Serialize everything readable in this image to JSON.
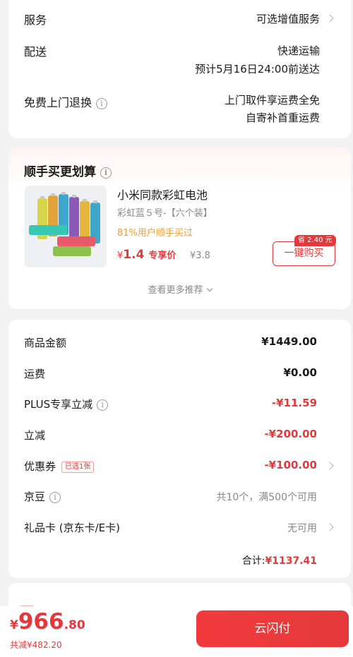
{
  "service": {
    "rows": [
      {
        "label": "服务",
        "value": "可选增值服务"
      },
      {
        "label": "配送",
        "value_line1": "快递运输",
        "value_line2": "预计5月16日24:00前送达"
      },
      {
        "label": "免费上门退换",
        "value_line1": "上门取件享运费全免",
        "value_line2": "自寄补首重运费"
      }
    ]
  },
  "addon": {
    "title": "顺手买更划算",
    "product": {
      "name": "小米同款彩虹电池",
      "spec": "彩虹蓝５号-【六个装】",
      "bought": "81%用户顺手买过",
      "price_symbol": "¥",
      "price": "1.4",
      "price_tag": "专享价",
      "original": "¥3.8",
      "save_badge": "省 2.40 元",
      "buy_label": "一键购买"
    },
    "more_label": "查看更多推荐"
  },
  "summary": {
    "goods_label": "商品金额",
    "goods_value": "¥1449.00",
    "shipping_label": "运费",
    "shipping_value": "¥0.00",
    "plus_label": "PLUS专享立减",
    "plus_value": "-¥11.59",
    "discount_label": "立减",
    "discount_value": "-¥200.00",
    "coupon_label": "优惠券",
    "coupon_tag": "已选1张",
    "coupon_value": "-¥100.00",
    "jingdou_label": "京豆",
    "jingdou_value": "共10个，满500个可用",
    "giftcard_label": "礼品卡 (京东卡/E卡)",
    "giftcard_value": "无可用",
    "total_label": "合计:",
    "total_value": "¥1137.41"
  },
  "footer": {
    "symbol": "¥",
    "amount_int": "966",
    "amount_dec": ".80",
    "saved": "共减¥482.20",
    "pay_button": "云闪付"
  },
  "colors": {
    "accent": "#e4393c",
    "orange": "#e8a13a",
    "gray": "#888888"
  }
}
